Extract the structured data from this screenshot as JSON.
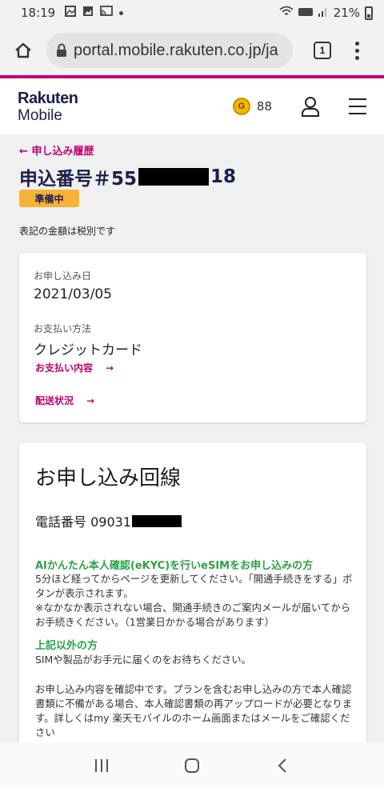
{
  "status_bar": {
    "time": "18:19",
    "battery": "21%",
    "icons": [
      "gallery-icon",
      "photo-icon",
      "cast-icon",
      "dot-icon",
      "wifi-icon",
      "volte-icon",
      "signal-icon",
      "battery-icon"
    ]
  },
  "browser": {
    "url": "portal.mobile.rakuten.co.jp/ja",
    "tab_count": "1"
  },
  "header": {
    "logo_line1": "Rakuten",
    "logo_line2": "Mobile",
    "points": "88",
    "medal_letter": "G"
  },
  "order": {
    "back_link": "申し込み履歴",
    "title_prefix": "申込番号＃55",
    "title_suffix": "18",
    "status_badge": "準備中",
    "tax_note": "表記の金額は税別です"
  },
  "details_card": {
    "date_label": "お申し込み日",
    "date_value": "2021/03/05",
    "payment_label": "お支払い方法",
    "payment_value": "クレジットカード",
    "payment_link": "お支払い内容",
    "shipping_link": "配送状況",
    "arrow": "→"
  },
  "line_card": {
    "title": "お申し込み回線",
    "phone_label": "電話番号 09031",
    "ekyc_heading": "AIかんたん本人確認(eKYC)を行いeSIMをお申し込みの方",
    "ekyc_text1": "5分ほど経ってからページを更新してください。「開通手続きをする」ボタンが表示されます。",
    "ekyc_text2": "※なかなか表示されない場合、開通手続きのご案内メールが届いてからお手続きください。（1営業日かかる場合があります）",
    "other_heading": "上記以外の方",
    "other_text": "SIMや製品がお手元に届くのをお待ちください。",
    "confirm_text": "お申し込み内容を確認中です。プランを含むお申し込みの方で本人確認書類に不備がある場合、本人確認書類の再アップロードが必要となります。詳しくはmy 楽天モバイルのホーム画面またはメールをご確認ください"
  },
  "colors": {
    "brand": "#bf0070",
    "navy": "#1d1d4e",
    "badge": "#f7b336",
    "green": "#2aa344"
  }
}
